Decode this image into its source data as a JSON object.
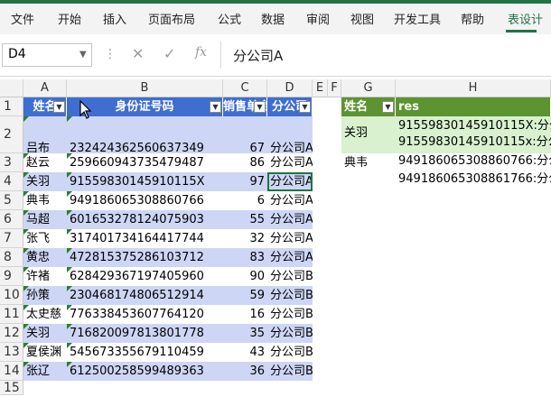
{
  "ribbon": {
    "tabs": [
      "文件",
      "开始",
      "插入",
      "页面布局",
      "公式",
      "数据",
      "审阅",
      "视图",
      "开发工具",
      "帮助",
      "表设计"
    ],
    "active_tab": "表设计"
  },
  "formula_bar": {
    "name_box": "D4",
    "cancel_icon": "✕",
    "confirm_icon": "✓",
    "fx_label": "fx",
    "content": "分公司A"
  },
  "columns": [
    "A",
    "B",
    "C",
    "D",
    "E",
    "F",
    "G",
    "H"
  ],
  "table1": {
    "headers": [
      "姓名",
      "身份证号码",
      "销售单金",
      "分公司"
    ],
    "rows": [
      {
        "row": "2",
        "name": "吕布",
        "id": "232424362560637349",
        "amount": "67",
        "branch": "分公司A"
      },
      {
        "row": "3",
        "name": "赵云",
        "id": "259660943735479487",
        "amount": "86",
        "branch": "分公司A"
      },
      {
        "row": "4",
        "name": "关羽",
        "id": "91559830145910115X",
        "amount": "97",
        "branch": "分公司A"
      },
      {
        "row": "5",
        "name": "典韦",
        "id": "949186065308860766",
        "amount": "6",
        "branch": "分公司A"
      },
      {
        "row": "6",
        "name": "马超",
        "id": "601653278124075903",
        "amount": "55",
        "branch": "分公司A"
      },
      {
        "row": "7",
        "name": "张飞",
        "id": "317401734164417744",
        "amount": "32",
        "branch": "分公司A"
      },
      {
        "row": "8",
        "name": "黄忠",
        "id": "472815375286103712",
        "amount": "83",
        "branch": "分公司A"
      },
      {
        "row": "9",
        "name": "许褚",
        "id": "628429367197405960",
        "amount": "90",
        "branch": "分公司B"
      },
      {
        "row": "10",
        "name": "孙策",
        "id": "230468174806512914",
        "amount": "59",
        "branch": "分公司B"
      },
      {
        "row": "11",
        "name": "太史慈",
        "id": "776338453607764120",
        "amount": "16",
        "branch": "分公司B"
      },
      {
        "row": "12",
        "name": "关羽",
        "id": "716820097813801778",
        "amount": "35",
        "branch": "分公司B"
      },
      {
        "row": "13",
        "name": "夏侯渊",
        "id": "545673355679110459",
        "amount": "43",
        "branch": "分公司B"
      },
      {
        "row": "14",
        "name": "张辽",
        "id": "612500258599489363",
        "amount": "36",
        "branch": "分公司B"
      }
    ]
  },
  "table2": {
    "headers": [
      "姓名",
      "res"
    ],
    "rows": [
      {
        "name": "关羽",
        "line1": "91559830145910115X:分公",
        "line2": "91559830145910115x:分公"
      },
      {
        "name": "典韦",
        "line1": "949186065308860766:分公",
        "line2": "949186065308861766:分公"
      }
    ]
  }
}
